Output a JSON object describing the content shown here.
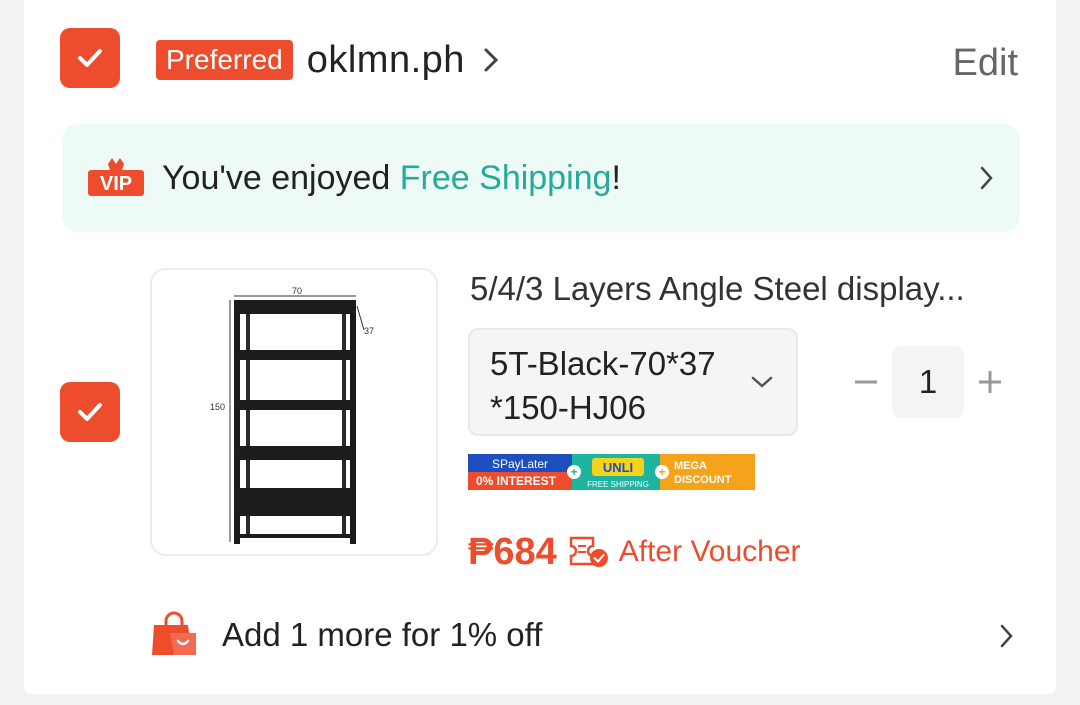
{
  "shop": {
    "badge": "Preferred",
    "name": "oklmn.ph",
    "edit_label": "Edit"
  },
  "shipping_banner": {
    "vip_label": "VIP",
    "text_prefix": "You've enjoyed ",
    "text_highlight": "Free Shipping",
    "text_suffix": "!"
  },
  "product": {
    "title": "5/4/3 Layers Angle Steel display...",
    "variant_line1": "5T-Black-70*37",
    "variant_line2": "*150-HJ06",
    "quantity": "1",
    "image_dims": {
      "width": "70",
      "depth": "37",
      "height": "150"
    },
    "promo": {
      "spaylater": "SPayLater",
      "interest": "0% INTEREST",
      "unli": "UNLI",
      "unli_sub": "FREE SHIPPING",
      "mega": "MEGA",
      "discount": "DISCOUNT"
    },
    "price": "₱684",
    "after_voucher": "After Voucher"
  },
  "add_more": {
    "text": "Add 1 more for 1% off"
  },
  "colors": {
    "brand": "#ee4d2d",
    "free_shipping": "#26aa99",
    "banner_bg": "#eefaf6"
  },
  "icons": [
    "check-icon",
    "chevron-right-icon",
    "vip-icon",
    "chevron-down-icon",
    "minus-icon",
    "plus-icon",
    "voucher-icon",
    "shopping-bag-icon"
  ]
}
